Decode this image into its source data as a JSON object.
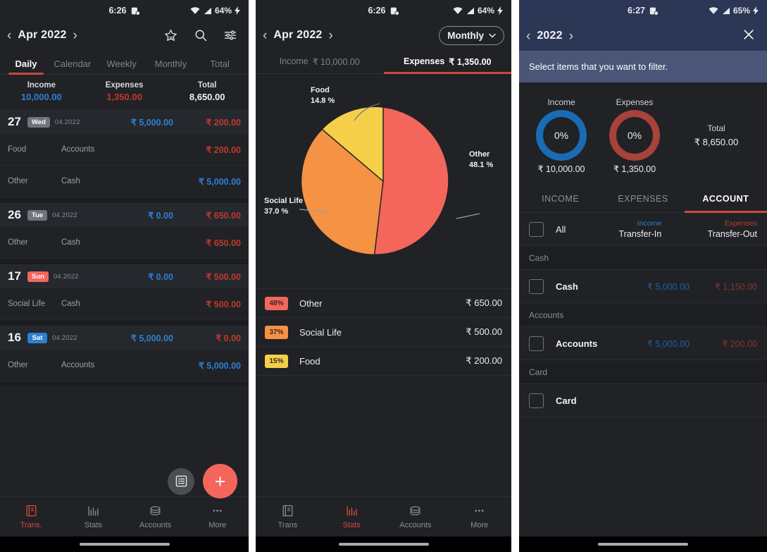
{
  "panel1": {
    "status": {
      "time": "6:26",
      "battery": "64%",
      "icons": [
        "notification-icon",
        "wifi-icon",
        "signal-icon",
        "charging-icon"
      ]
    },
    "nav": {
      "title": "Apr 2022",
      "prev": "‹",
      "next": "›",
      "icons": [
        "star-icon",
        "search-icon",
        "filter-icon"
      ]
    },
    "tabs": [
      {
        "label": "Daily",
        "active": true
      },
      {
        "label": "Calendar",
        "active": false
      },
      {
        "label": "Weekly",
        "active": false
      },
      {
        "label": "Monthly",
        "active": false
      },
      {
        "label": "Total",
        "active": false
      }
    ],
    "summary": [
      {
        "label": "Income",
        "value": "10,000.00",
        "color": "#2f7fd1"
      },
      {
        "label": "Expenses",
        "value": "1,350.00",
        "color": "#c0392b"
      },
      {
        "label": "Total",
        "value": "8,650.00",
        "color": "#f0f1f3"
      }
    ],
    "days": [
      {
        "day": "27",
        "weekday": "Wed",
        "badge_color": "#6f757d",
        "date": "04.2022",
        "income": "₹ 5,000.00",
        "expense": "₹ 200.00",
        "rows": [
          {
            "category": "Food",
            "account": "Accounts",
            "amount": "₹ 200.00",
            "color": "#c0392b"
          },
          {
            "category": "Other",
            "account": "Cash",
            "amount": "₹ 5,000.00",
            "color": "#2f7fd1"
          }
        ]
      },
      {
        "day": "26",
        "weekday": "Tue",
        "badge_color": "#6f757d",
        "date": "04.2022",
        "income": "₹ 0.00",
        "expense": "₹ 650.00",
        "rows": [
          {
            "category": "Other",
            "account": "Cash",
            "amount": "₹ 650.00",
            "color": "#c0392b"
          }
        ]
      },
      {
        "day": "17",
        "weekday": "Sun",
        "badge_color": "#f4665c",
        "date": "04.2022",
        "income": "₹ 0.00",
        "expense": "₹ 500.00",
        "rows": [
          {
            "category": "Social Life",
            "account": "Cash",
            "amount": "₹ 500.00",
            "color": "#c0392b"
          }
        ]
      },
      {
        "day": "16",
        "weekday": "Sat",
        "badge_color": "#2f7fd1",
        "date": "04.2022",
        "income": "₹ 5,000.00",
        "expense": "₹ 0.00",
        "rows": [
          {
            "category": "Other",
            "account": "Accounts",
            "amount": "₹ 5,000.00",
            "color": "#2f7fd1"
          }
        ]
      }
    ],
    "fab": {
      "list_icon": "list-icon",
      "add_label": "+"
    },
    "bottomnav": [
      {
        "label": "Trans.",
        "icon": "book-icon",
        "active": true
      },
      {
        "label": "Stats",
        "icon": "bar-chart-icon",
        "active": false
      },
      {
        "label": "Accounts",
        "icon": "coins-icon",
        "active": false
      },
      {
        "label": "More",
        "icon": "ellipsis-icon",
        "active": false
      }
    ]
  },
  "panel2": {
    "status": {
      "time": "6:26",
      "battery": "64%"
    },
    "nav": {
      "title": "Apr 2022",
      "period": "Monthly"
    },
    "ietabs": [
      {
        "label": "Income",
        "amount": "₹ 10,000.00",
        "active": false
      },
      {
        "label": "Expenses",
        "amount": "₹ 1,350.00",
        "active": true
      }
    ],
    "legend": [
      {
        "pct": "48%",
        "name": "Other",
        "amount": "₹ 650.00",
        "color": "#f4665c"
      },
      {
        "pct": "37%",
        "name": "Social Life",
        "amount": "₹ 500.00",
        "color": "#f59243"
      },
      {
        "pct": "15%",
        "name": "Food",
        "amount": "₹ 200.00",
        "color": "#f5cf4a"
      }
    ],
    "bottomnav": [
      {
        "label": "Trans",
        "active": false
      },
      {
        "label": "Stats",
        "active": true
      },
      {
        "label": "Accounts",
        "active": false
      },
      {
        "label": "More",
        "active": false
      }
    ],
    "chart_data": {
      "type": "pie",
      "title": "",
      "categories": [
        "Other",
        "Social Life",
        "Food"
      ],
      "values": [
        650,
        500,
        200
      ],
      "percentages": [
        48.1,
        37.0,
        14.8
      ],
      "labels": [
        "Other\n48.1 %",
        "Social Life\n37.0 %",
        "Food\n14.8 %"
      ],
      "colors": [
        "#f4665c",
        "#f59243",
        "#f5cf4a"
      ],
      "legend": "below",
      "currency": "₹",
      "total": 1350
    }
  },
  "panel3": {
    "status": {
      "time": "6:27",
      "battery": "65%"
    },
    "nav": {
      "title": "2022",
      "prev": "‹",
      "next": "›",
      "close": "×"
    },
    "banner": "Select items that you want to filter.",
    "donuts": [
      {
        "label": "Income",
        "pct": "0%",
        "amount": "₹ 10,000.00",
        "color": "#1a6bb5"
      },
      {
        "label": "Expenses",
        "pct": "0%",
        "amount": "₹ 1,350.00",
        "color": "#a8423a"
      }
    ],
    "total": {
      "label": "Total",
      "value": "₹ 8,650.00"
    },
    "tabs": [
      {
        "label": "INCOME",
        "active": false
      },
      {
        "label": "EXPENSES",
        "active": false
      },
      {
        "label": "ACCOUNT",
        "active": true
      }
    ],
    "allrow": {
      "name": "All",
      "income_label": "Income",
      "income_sub": "Transfer-In",
      "expense_label": "Expenses",
      "expense_sub": "Transfer-Out"
    },
    "groups": [
      {
        "header": "Cash",
        "items": [
          {
            "name": "Cash",
            "income": "₹ 5,000.00",
            "expense": "₹ 1,150.00"
          }
        ]
      },
      {
        "header": "Accounts",
        "items": [
          {
            "name": "Accounts",
            "income": "₹ 5,000.00",
            "expense": "₹ 200.00"
          }
        ]
      },
      {
        "header": "Card",
        "items": [
          {
            "name": "Card",
            "income": "",
            "expense": ""
          }
        ]
      }
    ]
  }
}
